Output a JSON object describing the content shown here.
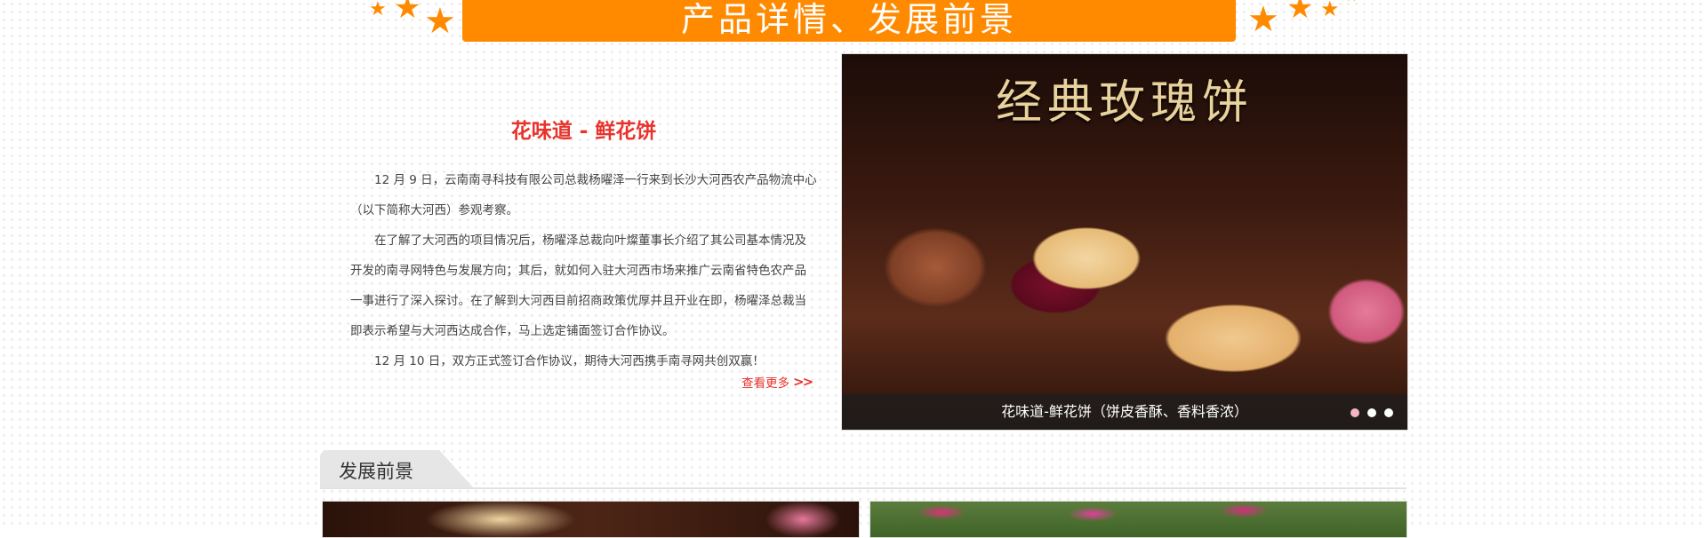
{
  "banner": {
    "title": "产品详情、发展前景",
    "color": "#ff8a00"
  },
  "article": {
    "title": "花味道 - 鲜花饼",
    "paragraphs": [
      "12 月 9 日，云南南寻科技有限公司总裁杨曜泽一行来到长沙大河西农产品物流中心（以下简称大河西）参观考察。",
      "在了解了大河西的项目情况后，杨曜泽总裁向叶燦董事长介绍了其公司基本情况及开发的南寻网特色与发展方向；其后，就如何入驻大河西市场来推广云南省特色农产品一事进行了深入探讨。在了解到大河西目前招商政策优厚并且开业在即，杨曜泽总裁当即表示希望与大河西达成合作，马上选定铺面签订合作协议。",
      "12 月 10 日，双方正式签订合作协议，期待大河西携手南寻网共创双赢！"
    ],
    "more_label": "查看更多",
    "more_arrow": ">>",
    "accent_color": "#e8332c"
  },
  "slideshow": {
    "heading": "经典玫瑰饼",
    "caption": "花味道-鲜花饼（饼皮香酥、香料香浓）",
    "dots": 3,
    "active_dot": 0
  },
  "section": {
    "title": "发展前景"
  }
}
